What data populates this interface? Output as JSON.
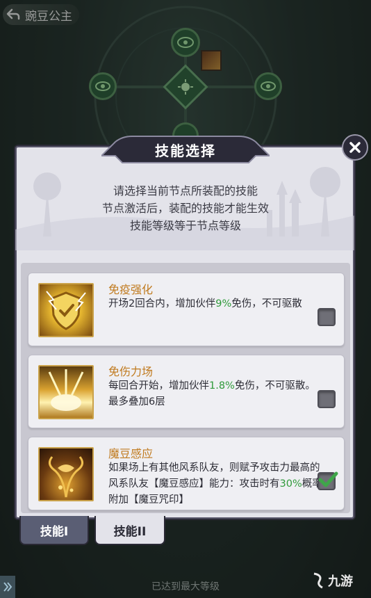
{
  "header": {
    "back_label": "豌豆公主"
  },
  "dialog": {
    "title": "技能选择",
    "instructions": [
      "请选择当前节点所装配的技能",
      "节点激活后，装配的技能才能生效",
      "技能等级等于节点等级"
    ]
  },
  "skills": [
    {
      "name": "免疫强化",
      "desc_before": "开场2回合内，增加伙伴",
      "highlight": "9%",
      "desc_after": "免伤，不可驱散",
      "checked": false,
      "icon": "shield-lightning-icon"
    },
    {
      "name": "免伤力场",
      "desc_before": "每回合开始，增加伙伴",
      "highlight": "1.8%",
      "desc_after": "免伤，不可驱散。最多叠加6层",
      "checked": false,
      "icon": "force-field-icon"
    },
    {
      "name": "魔豆感应",
      "desc_before": "如果场上有其他风系队友，则赋予攻击力最高的风系队友【魔豆感应】能力：攻击时有",
      "highlight": "30%",
      "desc_after": "概率附加【魔豆咒印】",
      "checked": true,
      "icon": "magic-bean-icon"
    }
  ],
  "tabs": [
    {
      "label": "技能I",
      "active": false
    },
    {
      "label": "技能II",
      "active": true
    }
  ],
  "footer": {
    "status": "已达到最大等级",
    "watermark": "九游"
  },
  "colors": {
    "accent_name": "#c07a1e",
    "highlight": "#2f9a3a",
    "panel": "#e3e3ea"
  }
}
